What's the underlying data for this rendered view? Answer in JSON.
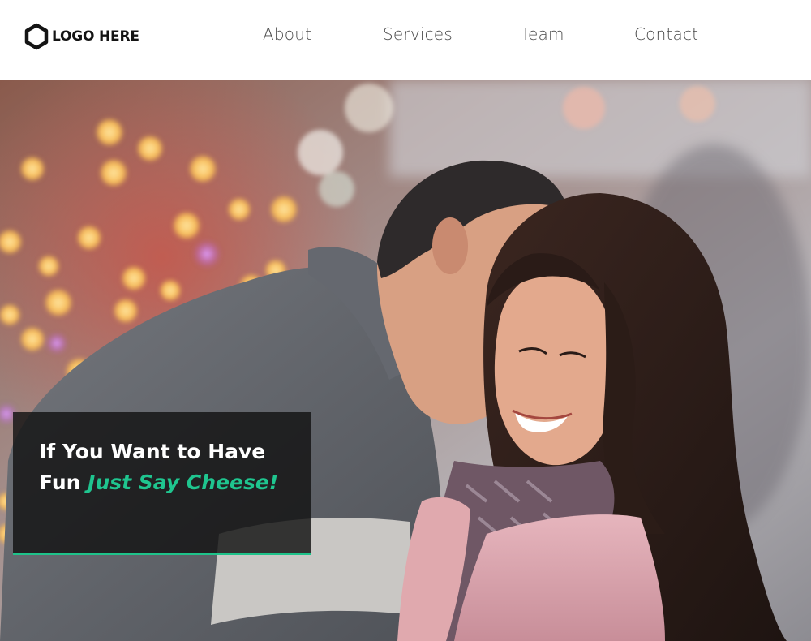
{
  "header": {
    "logo_text": "LOGO HERE",
    "logo_icon": "hexagon-icon",
    "nav": [
      {
        "label": "About"
      },
      {
        "label": "Services"
      },
      {
        "label": "Team"
      },
      {
        "label": "Contact"
      }
    ]
  },
  "hero": {
    "image_description": "couple-embracing-bokeh-photo",
    "caption": {
      "line_prefix": "If You Want to Have Fun ",
      "accent": "Just Say Cheese!"
    }
  },
  "colors": {
    "accent": "#1fc58f",
    "caption_bg": "#121212",
    "nav_text": "#4a4a4a",
    "logo_text": "#141414"
  }
}
